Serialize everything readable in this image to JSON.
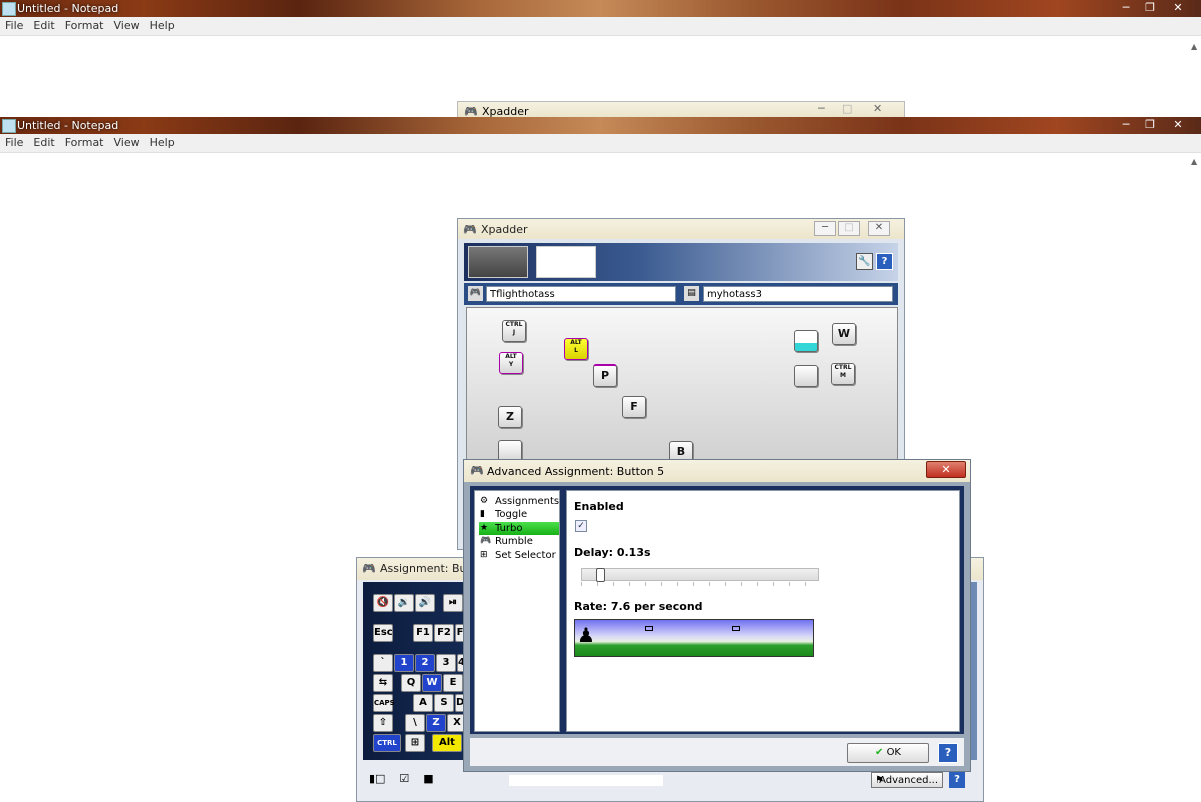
{
  "notepad_top": {
    "title": "Untitled - Notepad",
    "menu": [
      "File",
      "Edit",
      "Format",
      "View",
      "Help"
    ]
  },
  "notepad_main": {
    "title": "Untitled - Notepad",
    "menu": [
      "File",
      "Edit",
      "Format",
      "View",
      "Help"
    ]
  },
  "xpadder_ghost": {
    "title": "Xpadder"
  },
  "xpadder": {
    "title": "Xpadder",
    "controller_name": "Tflighthotass",
    "profile_name": "myhotass3",
    "keys": [
      {
        "label": "Ctrl\nJ"
      },
      {
        "label": "Alt\nY"
      },
      {
        "label": "Alt\nL"
      },
      {
        "label": "P"
      },
      {
        "label": "F"
      },
      {
        "label": "Z"
      },
      {
        "label": "B"
      },
      {
        "label": "W"
      },
      {
        "label": "Ctrl\nM"
      }
    ]
  },
  "assignment_window": {
    "title": "Assignment: Butto",
    "advanced_label": "Advanced...",
    "keys": [
      "Esc",
      "F1",
      "F2",
      "F",
      "`",
      "1",
      "2",
      "3",
      "4",
      "Q",
      "W",
      "E",
      "A",
      "S",
      "D",
      "\\",
      "Z",
      "X",
      "Alt"
    ]
  },
  "advanced": {
    "title": "Advanced Assignment: Button 5",
    "menu": [
      {
        "label": "Assignments",
        "selected": false
      },
      {
        "label": "Toggle",
        "selected": false
      },
      {
        "label": "Turbo",
        "selected": true
      },
      {
        "label": "Rumble",
        "selected": false
      },
      {
        "label": "Set Selector",
        "selected": false
      }
    ],
    "enabled_label": "Enabled",
    "enabled_checked": true,
    "delay_label": "Delay: 0.13s",
    "delay_fraction": 0.06,
    "rate_label": "Rate: 7.6 per second",
    "ok_label": "OK",
    "help_label": "?"
  },
  "colors": {
    "accent_green": "#1fb31f",
    "selected_green": "#22c422",
    "title_blue": "#1b2f5e"
  }
}
